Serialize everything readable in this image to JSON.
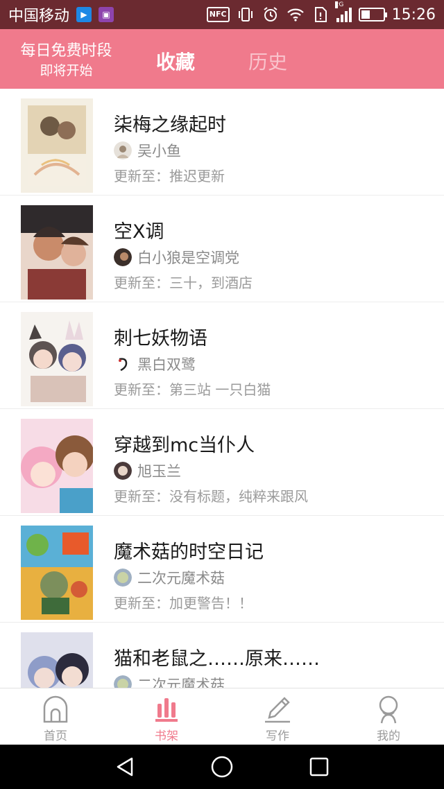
{
  "status_bar": {
    "carrier": "中国移动",
    "network_badge": "2G",
    "nfc": "NFC",
    "time": "15:26"
  },
  "header": {
    "promo_line1": "每日免费时段",
    "promo_line2": "即将开始",
    "tabs": [
      {
        "label": "收藏",
        "active": true
      },
      {
        "label": "历史",
        "active": false
      }
    ]
  },
  "books": [
    {
      "title": "柒梅之缘起时",
      "author": "吴小鱼",
      "update": "更新至：推迟更新"
    },
    {
      "title": "空X调",
      "author": "白小狼是空调党",
      "update": "更新至：三十，到酒店"
    },
    {
      "title": "刺七妖物语",
      "author": "黑白双鹭",
      "update": "更新至：第三站 一只白猫"
    },
    {
      "title": "穿越到mc当仆人",
      "author": "旭玉兰",
      "update": "更新至：没有标题，纯粹来跟风"
    },
    {
      "title": "魔术菇的时空日记",
      "author": "二次元魔术菇",
      "update": "更新至：加更警告！！"
    },
    {
      "title": "猫和老鼠之……原来……",
      "author": "二次元魔术菇",
      "update": ""
    }
  ],
  "bottom_nav": [
    {
      "label": "首页",
      "icon": "home-icon",
      "active": false
    },
    {
      "label": "书架",
      "icon": "bookshelf-icon",
      "active": true
    },
    {
      "label": "写作",
      "icon": "pen-icon",
      "active": false
    },
    {
      "label": "我的",
      "icon": "profile-icon",
      "active": false
    }
  ],
  "colors": {
    "accent": "#f07a8c",
    "status_bar": "#6b2a30",
    "inactive_tab": "#f9c3cc"
  }
}
